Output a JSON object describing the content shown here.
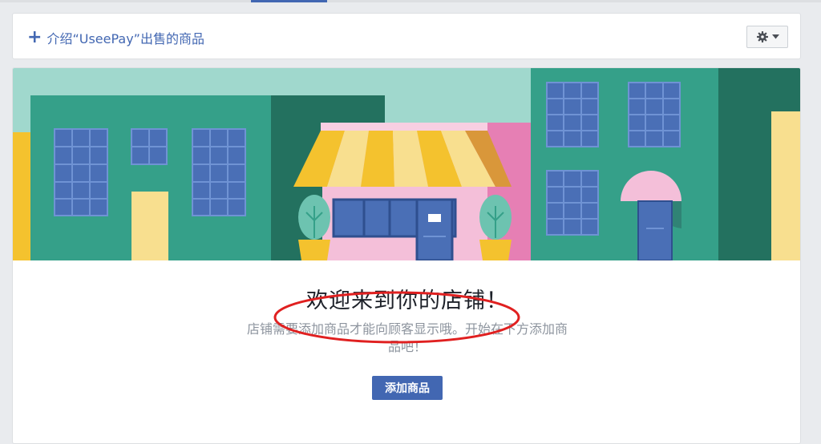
{
  "header": {
    "add_products_label": "介绍“UseePay”出售的商品"
  },
  "welcome": {
    "title": "欢迎来到你的店铺！",
    "description": "店铺需要添加商品才能向顾客显示哦。开始在下方添加商品吧！",
    "button_label": "添加商品"
  },
  "colors": {
    "accent": "#4267b2",
    "annotation": "#e02020"
  },
  "icons": [
    "plus-icon",
    "gear-icon",
    "caret-down-icon"
  ]
}
